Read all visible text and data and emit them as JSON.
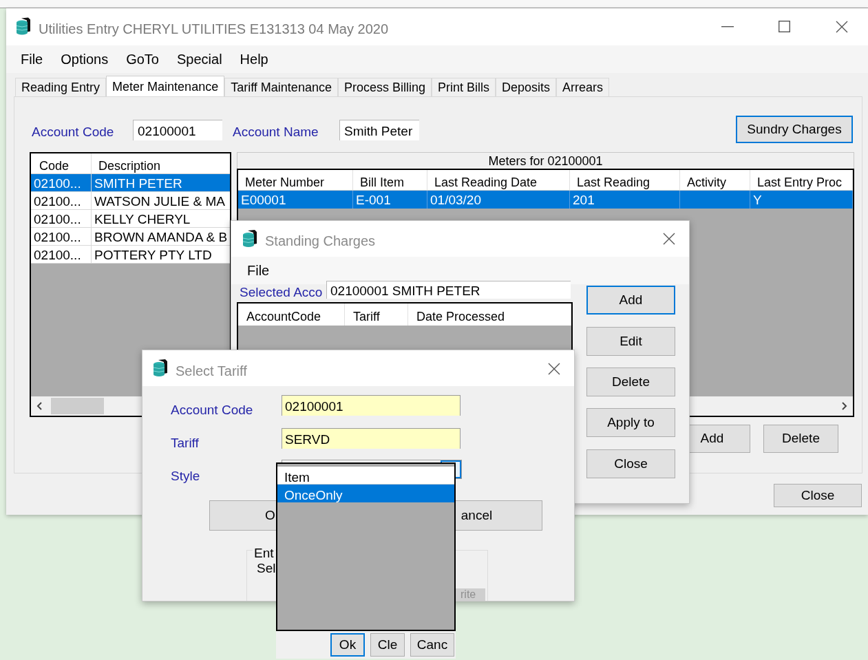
{
  "main_window": {
    "title": "Utilities Entry CHERYL UTILITIES E131313 04 May 2020",
    "menu": [
      "File",
      "Options",
      "GoTo",
      "Special",
      "Help"
    ],
    "tabs": [
      {
        "label": "Reading Entry",
        "selected": false
      },
      {
        "label": "Meter Maintenance",
        "selected": true
      },
      {
        "label": "Tariff Maintenance",
        "selected": false
      },
      {
        "label": "Process Billing",
        "selected": false
      },
      {
        "label": "Print Bills",
        "selected": false
      },
      {
        "label": "Deposits",
        "selected": false
      },
      {
        "label": "Arrears",
        "selected": false
      }
    ],
    "fields": [
      {
        "label": "Account Code",
        "value": "02100001"
      },
      {
        "label": "Account Name",
        "value": "Smith Peter"
      }
    ],
    "sundry_button": "Sundry Charges",
    "accounts": {
      "columns": [
        "Code",
        "Description"
      ],
      "rows": [
        {
          "code": "02100...",
          "description": "SMITH PETER",
          "selected": true
        },
        {
          "code": "02100...",
          "description": "WATSON JULIE & MA",
          "selected": false
        },
        {
          "code": "02100...",
          "description": "KELLY CHERYL",
          "selected": false
        },
        {
          "code": "02100...",
          "description": "BROWN AMANDA & B",
          "selected": false
        },
        {
          "code": "02100...",
          "description": "POTTERY PTY LTD",
          "selected": false
        }
      ]
    },
    "meters": {
      "title": "Meters for 02100001",
      "columns": [
        "Meter Number",
        "Bill Item",
        "Last Reading Date",
        "Last Reading",
        "Activity",
        "Last Entry Proc"
      ],
      "rows": [
        {
          "meter_number": "E00001",
          "bill_item": "E-001",
          "last_reading_date": "01/03/20",
          "last_reading": "201",
          "last_entry_proc": "Y",
          "selected": true
        }
      ]
    },
    "buttons": [
      "Add",
      "Delete"
    ],
    "close_button": "Close"
  },
  "standing_charges": {
    "title": "Standing Charges",
    "menu": [
      "File"
    ],
    "selected_account_label": "Selected Acco",
    "selected_account": "02100001 SMITH PETER",
    "columns": [
      "AccountCode",
      "Tariff",
      "Date Processed"
    ],
    "buttons": [
      {
        "label": "Add",
        "focused": true
      },
      {
        "label": "Edit",
        "focused": false
      },
      {
        "label": "Delete",
        "focused": false
      },
      {
        "label": "Apply to",
        "focused": false
      },
      {
        "label": "Close",
        "focused": false
      }
    ]
  },
  "select_tariff": {
    "title": "Select Tariff",
    "fields": [
      {
        "label": "Account Code",
        "value": "02100001"
      },
      {
        "label": "Tariff",
        "value": "SERVD"
      }
    ],
    "style_label": "Style",
    "buttons": [
      "O",
      "ancel"
    ],
    "group_lines": [
      "Ent",
      "Sel"
    ],
    "group_button": "rite"
  },
  "style_dropdown": {
    "options": [
      {
        "label": "Item",
        "selected": false
      },
      {
        "label": "OnceOnly",
        "selected": true
      }
    ]
  },
  "background_buttons": [
    {
      "label": "Ok",
      "focused": true
    },
    {
      "label": "Cle",
      "focused": false
    },
    {
      "label": "Canc",
      "focused": false
    }
  ]
}
